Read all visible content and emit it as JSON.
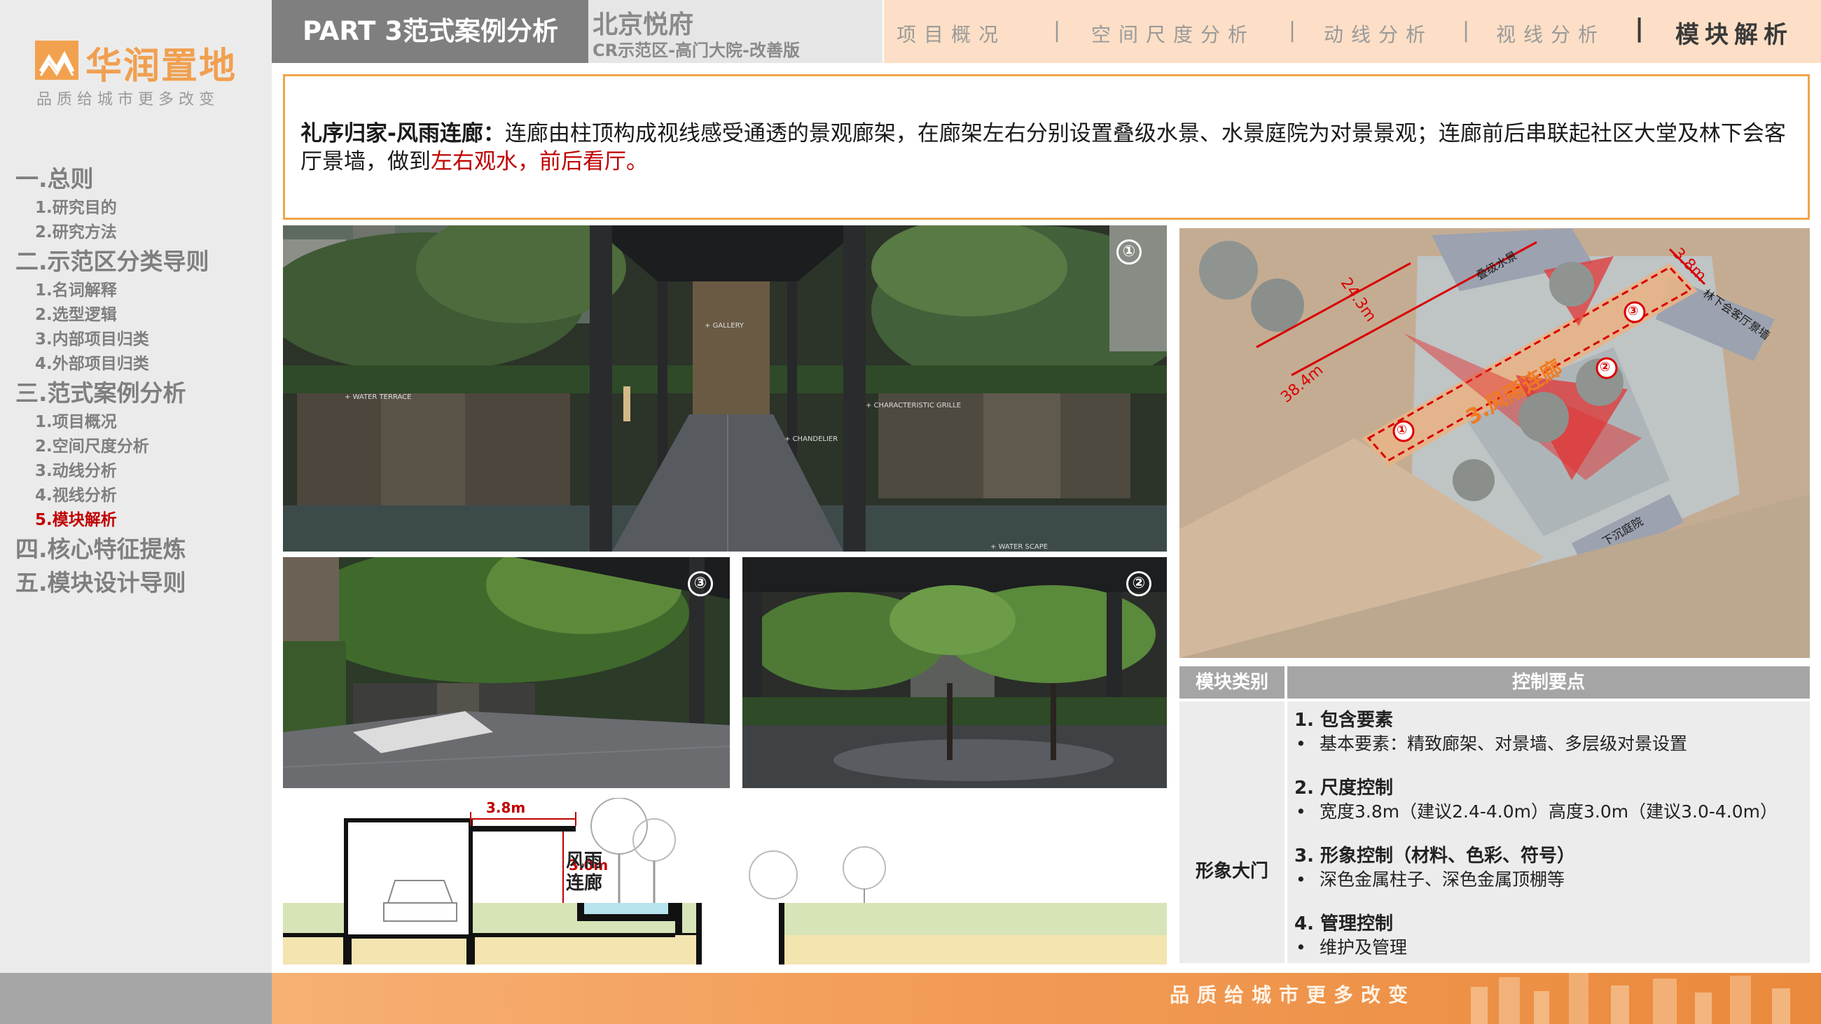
{
  "brand": {
    "name": "华润置地",
    "slogan": "品质给城市更多改变"
  },
  "sidebar": {
    "sections": [
      {
        "label": "一.总则",
        "items": [
          "1.研究目的",
          "2.研究方法"
        ]
      },
      {
        "label": "二.示范区分类导则",
        "items": [
          "1.名词解释",
          "2.选型逻辑",
          "3.内部项目归类",
          "4.外部项目归类"
        ]
      },
      {
        "label": "三.范式案例分析",
        "items": [
          "1.项目概况",
          "2.空间尺度分析",
          "3.动线分析",
          "4.视线分析",
          "5.模块解析"
        ]
      },
      {
        "label": "四.核心特征提炼",
        "items": []
      },
      {
        "label": "五.模块设计导则",
        "items": []
      }
    ],
    "active_item": "5.模块解析"
  },
  "header": {
    "part": "PART 3范式案例分析",
    "project_name": "北京悦府",
    "project_sub": "CR示范区-高门大院-改善版",
    "nav": [
      "项目概况",
      "空间尺度分析",
      "动线分析",
      "视线分析",
      "模块解析"
    ],
    "nav_active": "模块解析",
    "separator": "|"
  },
  "intro": {
    "lead": "礼序归家-风雨连廊：",
    "body": "连廊由柱顶构成视线感受通透的景观廊架，在廊架左右分别设置叠级水景、水景庭院为对景景观；连廊前后串联起社区大堂及林下会客厅景墙，做到",
    "highlight": "左右观水，前后看厅。"
  },
  "photos": {
    "main_badge": "①",
    "left_badge": "③",
    "right_badge": "②",
    "main_tags": [
      "GALLERY",
      "WATER TERRACE",
      "CHARACTERISTIC GRILLE",
      "CHANDELIER",
      "WATER SCAPE"
    ]
  },
  "plan": {
    "corridor_label": "3.风雨连廊",
    "dim_length_1": "24.3m",
    "dim_length_2": "38.4m",
    "dim_width": "3.8m",
    "tag_cascade": "叠级水景",
    "tag_lounge": "林下会客厅景墙",
    "tag_sunken": "下沉庭院",
    "markers": [
      "①",
      "②",
      "③"
    ]
  },
  "section": {
    "width": "3.8m",
    "height": "3.0m",
    "label_line1": "风雨",
    "label_line2": "连廊"
  },
  "table": {
    "header_type": "模块类别",
    "header_points": "控制要点",
    "row_type": "形象大门",
    "points": [
      {
        "title": "1. 包含要素",
        "item": "基本要素：精致廊架、对景墙、多层级对景设置"
      },
      {
        "title": "2. 尺度控制",
        "item": "宽度3.8m（建议2.4-4.0m）高度3.0m（建议3.0-4.0m）"
      },
      {
        "title": "3. 形象控制（材料、色彩、符号）",
        "item": "深色金属柱子、深色金属顶棚等"
      },
      {
        "title": "4. 管理控制",
        "item": "维护及管理"
      }
    ]
  },
  "footer": {
    "slogan": "品质给城市更多改变"
  },
  "colors": {
    "accent_orange": "#f1a44a",
    "active_red": "#c00000",
    "grey": "#7f7f7f"
  }
}
